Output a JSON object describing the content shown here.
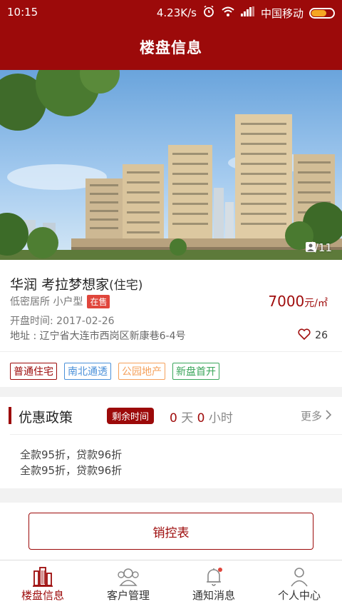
{
  "status_bar": {
    "time": "10:15",
    "speed": "4.23K/s",
    "carrier": "中国移动"
  },
  "nav": {
    "title": "楼盘信息"
  },
  "gallery": {
    "current": "1",
    "total": "11",
    "counter": "1/11"
  },
  "property": {
    "developer": "华润",
    "name": "考拉梦想家",
    "type": "(住宅)",
    "tags_line": "低密居所 小户型",
    "status_badge": "在售",
    "price_value": "7000",
    "price_unit": "元/㎡",
    "open_label": "开盘时间:",
    "open_date": "2017-02-26",
    "address_label": "地址 :",
    "address": "辽宁省大连市西岗区新康巷6-4号",
    "likes": "26",
    "feature_tags": [
      {
        "label": "普通住宅",
        "color": "#9c0a0a"
      },
      {
        "label": "南北通透",
        "color": "#4a90d9"
      },
      {
        "label": "公园地产",
        "color": "#f5a05a"
      },
      {
        "label": "新盘首开",
        "color": "#3aa55a"
      }
    ]
  },
  "promotion": {
    "heading": "优惠政策",
    "remain_label": "剩余时间",
    "days": "0",
    "days_unit": "天",
    "hours": "0",
    "hours_unit": "小时",
    "more": "更多",
    "items": [
      "全款95折，贷款96折",
      "全款95折，贷款96折"
    ]
  },
  "sales_button": "销控表",
  "tabs": [
    {
      "label": "楼盘信息",
      "icon": "building-icon",
      "active": true
    },
    {
      "label": "客户管理",
      "icon": "users-icon",
      "active": false
    },
    {
      "label": "通知消息",
      "icon": "bell-icon",
      "active": false
    },
    {
      "label": "个人中心",
      "icon": "person-icon",
      "active": false
    }
  ],
  "colors": {
    "primary": "#9c0a0a",
    "badge": "#e0463c",
    "price": "#a00d0d"
  }
}
